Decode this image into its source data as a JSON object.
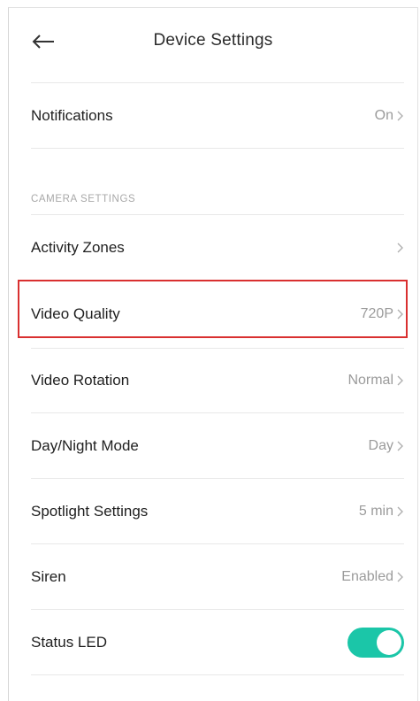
{
  "header": {
    "back_icon": "back-arrow-icon",
    "title": "Device Settings"
  },
  "notifications": {
    "label": "Notifications",
    "value": "On"
  },
  "camera_settings": {
    "section_label": "CAMERA SETTINGS",
    "rows": [
      {
        "label": "Activity Zones",
        "value": ""
      },
      {
        "label": "Video Quality",
        "value": "720P"
      },
      {
        "label": "Video Rotation",
        "value": "Normal"
      },
      {
        "label": "Day/Night Mode",
        "value": "Day"
      },
      {
        "label": "Spotlight Settings",
        "value": "5 min"
      },
      {
        "label": "Siren",
        "value": "Enabled"
      }
    ],
    "status_led": {
      "label": "Status LED",
      "enabled": true
    }
  },
  "colors": {
    "accent": "#1bc6a8",
    "highlight": "#d93030",
    "secondary_text": "#9b9b9b",
    "divider": "#e8e8e8"
  }
}
